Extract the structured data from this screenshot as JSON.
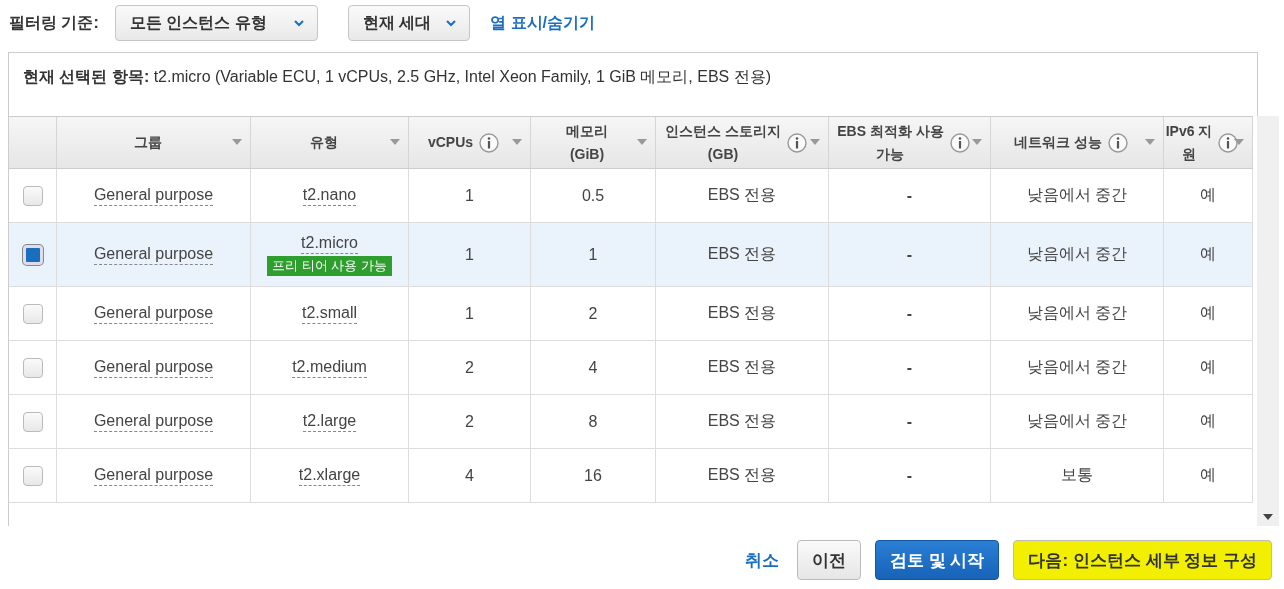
{
  "filter_bar": {
    "label": "필터링 기준:",
    "dropdowns": [
      {
        "value": "모든 인스턴스 유형"
      },
      {
        "value": "현재 세대"
      }
    ],
    "link": "열 표시/숨기기"
  },
  "selection": {
    "label": "현재 선택된 항목:",
    "text": "t2.micro (Variable ECU, 1 vCPUs, 2.5 GHz, Intel Xeon Family, 1 GiB 메모리, EBS 전용)"
  },
  "table": {
    "columns": [
      {
        "lines": [
          "그룹"
        ],
        "info": false
      },
      {
        "lines": [
          "유형"
        ],
        "info": false
      },
      {
        "lines": [
          "vCPUs"
        ],
        "info": true
      },
      {
        "lines": [
          "메모리",
          "(GiB)"
        ],
        "info": false
      },
      {
        "lines": [
          "인스턴스 스토리지",
          "(GB)"
        ],
        "info": true
      },
      {
        "lines": [
          "EBS 최적화 사용",
          "가능"
        ],
        "info": true
      },
      {
        "lines": [
          "네트워크 성능"
        ],
        "info": true
      },
      {
        "lines": [
          "IPv6 지",
          "원"
        ],
        "info": true
      }
    ],
    "rows": [
      {
        "selected": false,
        "highlighted": false,
        "group": "General purpose",
        "type": "t2.nano",
        "vcpus": "1",
        "memory": "0.5",
        "storage": "EBS 전용",
        "ebs": "-",
        "network": "낮음에서 중간",
        "ipv6": "예"
      },
      {
        "selected": true,
        "highlighted": false,
        "group": "General purpose",
        "type": "t2.micro",
        "badge": "프리 티어 사용 가능",
        "vcpus": "1",
        "memory": "1",
        "storage": "EBS 전용",
        "ebs": "-",
        "network": "낮음에서 중간",
        "ipv6": "예"
      },
      {
        "selected": false,
        "highlighted": false,
        "group": "General purpose",
        "type": "t2.small",
        "vcpus": "1",
        "memory": "2",
        "storage": "EBS 전용",
        "ebs": "-",
        "network": "낮음에서 중간",
        "ipv6": "예"
      },
      {
        "selected": false,
        "highlighted": false,
        "group": "General purpose",
        "type": "t2.medium",
        "vcpus": "2",
        "memory": "4",
        "storage": "EBS 전용",
        "ebs": "-",
        "network": "낮음에서 중간",
        "ipv6": "예"
      },
      {
        "selected": false,
        "highlighted": false,
        "group": "General purpose",
        "type": "t2.large",
        "vcpus": "2",
        "memory": "8",
        "storage": "EBS 전용",
        "ebs": "-",
        "network": "낮음에서 중간",
        "ipv6": "예"
      },
      {
        "selected": false,
        "highlighted": false,
        "group": "General purpose",
        "type": "t2.xlarge",
        "vcpus": "4",
        "memory": "16",
        "storage": "EBS 전용",
        "ebs": "-",
        "network": "보통",
        "ipv6": "예"
      }
    ]
  },
  "buttons": [
    {
      "kind": "link",
      "label": "취소",
      "highlighted": false
    },
    {
      "kind": "default",
      "label": "이전",
      "highlighted": false
    },
    {
      "kind": "primary",
      "label": "검토 및 시작",
      "highlighted": false
    },
    {
      "kind": "default",
      "label": "다음: 인스턴스 세부 정보 구성",
      "highlighted": true
    }
  ]
}
